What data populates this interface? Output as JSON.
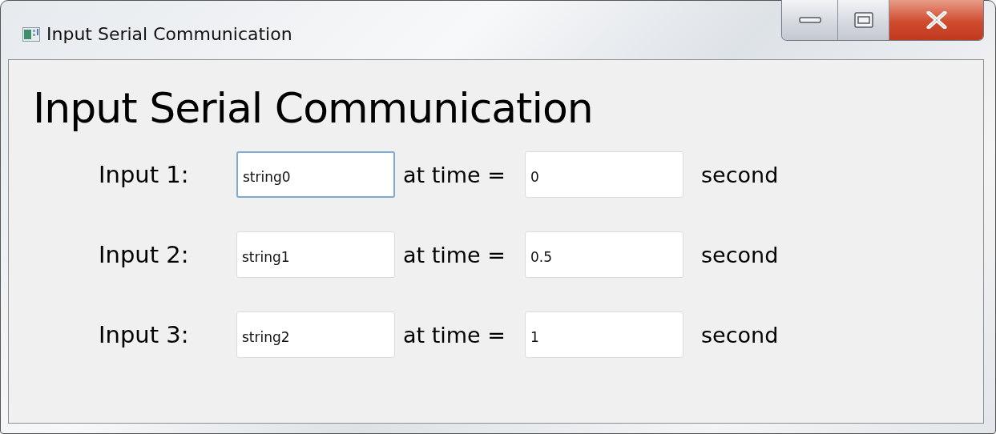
{
  "window": {
    "title": "Input Serial Communication"
  },
  "heading": "Input Serial Communication",
  "rows": [
    {
      "label": "Input 1:",
      "value": "string0",
      "focused": true,
      "time_label": "at time =",
      "time": "0",
      "unit": "second"
    },
    {
      "label": "Input 2:",
      "value": "string1",
      "focused": false,
      "time_label": "at time =",
      "time": "0.5",
      "unit": "second"
    },
    {
      "label": "Input 3:",
      "value": "string2",
      "focused": false,
      "time_label": "at time =",
      "time": "1",
      "unit": "second"
    }
  ]
}
